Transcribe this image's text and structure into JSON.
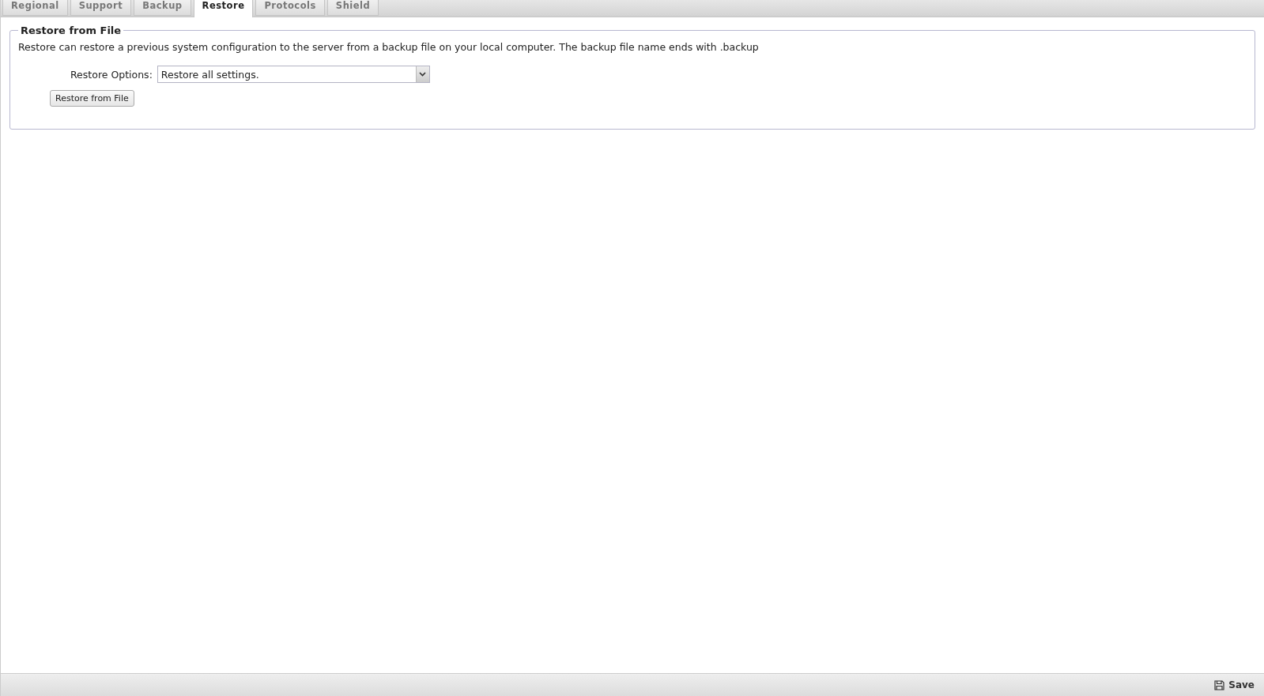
{
  "tabs": [
    {
      "label": "Regional",
      "selected": false
    },
    {
      "label": "Support",
      "selected": false
    },
    {
      "label": "Backup",
      "selected": false
    },
    {
      "label": "Restore",
      "selected": true
    },
    {
      "label": "Protocols",
      "selected": false
    },
    {
      "label": "Shield",
      "selected": false
    }
  ],
  "panel": {
    "title": "Restore from File",
    "description": "Restore can restore a previous system configuration to the server from a backup file on your local computer. The backup file name ends with .backup",
    "option_label": "Restore Options:",
    "option_value": "Restore all settings.",
    "button": "Restore from File"
  },
  "footer": {
    "save": "Save"
  }
}
